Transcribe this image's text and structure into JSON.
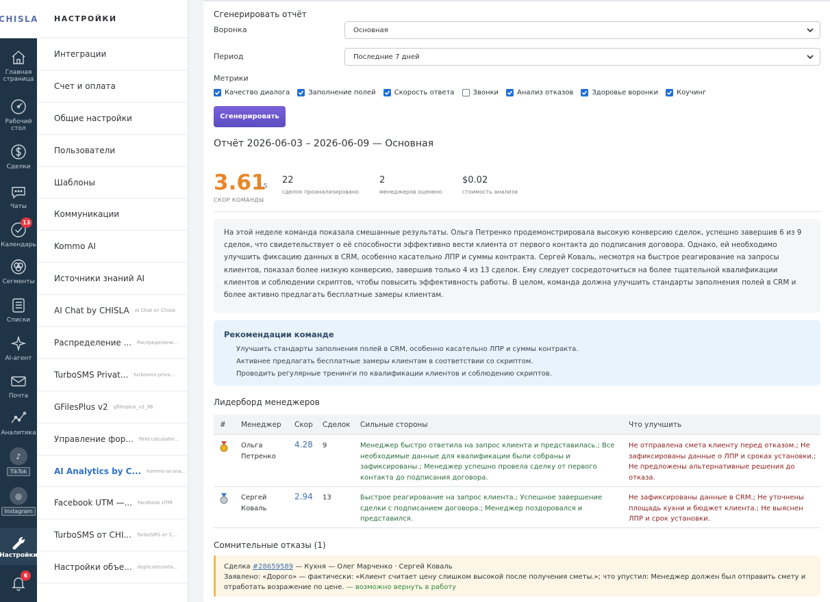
{
  "brand": {
    "logo": "CHISLA"
  },
  "rail": {
    "items": [
      {
        "label": "Главная страница",
        "icon": "home-icon"
      },
      {
        "label": "Рабочий стол",
        "icon": "dashboard-icon"
      },
      {
        "label": "Сделки",
        "icon": "dollar-icon"
      },
      {
        "label": "Чаты",
        "icon": "chat-icon"
      },
      {
        "label": "Календарь",
        "icon": "calendar-check-icon",
        "badge": "13"
      },
      {
        "label": "Сегменты",
        "icon": "segments-icon"
      },
      {
        "label": "Списки",
        "icon": "list-icon"
      },
      {
        "label": "AI-агент",
        "icon": "sparkle-icon"
      },
      {
        "label": "Почта",
        "icon": "mail-icon"
      },
      {
        "label": "Аналитика",
        "icon": "analytics-icon"
      }
    ],
    "tiktok": "TikTok",
    "instagram": "Instagram",
    "settings": "Настройки",
    "notifications_badge": "6"
  },
  "panel": {
    "title": "НАСТРОЙКИ",
    "items": [
      {
        "name": "Интеграции",
        "sub": ""
      },
      {
        "name": "Счет и оплата",
        "sub": ""
      },
      {
        "name": "Общие настройки",
        "sub": ""
      },
      {
        "name": "Пользователи",
        "sub": ""
      },
      {
        "name": "Шаблоны",
        "sub": ""
      },
      {
        "name": "Коммуникации",
        "sub": ""
      },
      {
        "name": "Kommo AI",
        "sub": ""
      },
      {
        "name": "Источники знаний AI",
        "sub": ""
      },
      {
        "name": "AI Chat by CHISLA",
        "sub": "AI Chat от Chisla"
      },
      {
        "name": "Распределение ...",
        "sub": "Распределени..."
      },
      {
        "name": "TurboSMS Privat...",
        "sub": "turbosms-priva..."
      },
      {
        "name": "GFilesPlus v2",
        "sub": "gfilesplus_v2_36"
      },
      {
        "name": "Управление фор...",
        "sub": "field-calculator..."
      },
      {
        "name": "AI Analytics by C...",
        "sub": "kommo-ai-ana..."
      },
      {
        "name": "Facebook UTM —...",
        "sub": "Facebook UTM"
      },
      {
        "name": "TurboSMS от CHI...",
        "sub": "TurboSMS от C..."
      },
      {
        "name": "Настройки объе...",
        "sub": "duplicateconta..."
      }
    ]
  },
  "form": {
    "section_title": "Сгенерировать отчёт",
    "funnel_label": "Воронка",
    "funnel_value": "Основная",
    "period_label": "Период",
    "period_value": "Последние 7 дней",
    "metrics_label": "Метрики",
    "metrics": [
      {
        "label": "Качество диалога",
        "checked": true
      },
      {
        "label": "Заполнение полей",
        "checked": true
      },
      {
        "label": "Скорость ответа",
        "checked": true
      },
      {
        "label": "Звонки",
        "checked": false
      },
      {
        "label": "Анализ отказов",
        "checked": true
      },
      {
        "label": "Здоровье воронки",
        "checked": true
      },
      {
        "label": "Коучинг",
        "checked": true
      }
    ],
    "generate_label": "Сгенерировать"
  },
  "report": {
    "title": "Отчёт 2026-06-03 – 2026-06-09 — Основная",
    "score": "3.61",
    "score_of": "/ 5",
    "score_caption": "СКОР КОМАНДЫ",
    "stats": [
      {
        "value": "22",
        "caption": "сделок проанализировано"
      },
      {
        "value": "2",
        "caption": "менеджеров оценено"
      },
      {
        "value": "$0.02",
        "caption": "стоимость анализа"
      }
    ],
    "summary": "На этой неделе команда показала смешанные результаты. Ольга Петренко продемонстрировала высокую конверсию сделок, успешно завершив 6 из 9 сделок, что свидетельствует о её способности эффективно вести клиента от первого контакта до подписания договора. Однако, ей необходимо улучшить фиксацию данных в CRM, особенно касательно ЛПР и суммы контракта. Сергей Коваль, несмотря на быстрое реагирование на запросы клиентов, показал более низкую конверсию, завершив только 4 из 13 сделок. Ему следует сосредоточиться на более тщательной квалификации клиентов и соблюдении скриптов, чтобы повысить эффективность работы. В целом, команда должна улучшить стандарты заполнения полей в CRM и более активно предлагать бесплатные замеры клиентам.",
    "recs_title": "Рекомендации команде",
    "recs": [
      "Улучшить стандарты заполнения полей в CRM, особенно касательно ЛПР и суммы контракта.",
      "Активнее предлагать бесплатные замеры клиентам в соответствии со скриптом.",
      "Проводить регулярные тренинги по квалификации клиентов и соблюдению скриптов."
    ],
    "leaderboard_title": "Лидерборд менеджеров",
    "columns": [
      "#",
      "Менеджер",
      "Скор",
      "Сделок",
      "Сильные стороны",
      "Что улучшить"
    ],
    "rows": [
      {
        "medal": "gold-medal-icon",
        "manager": "Ольга Петренко",
        "score": "4.28",
        "deals": "9",
        "strengths": "Менеджер быстро ответила на запрос клиента и представилась.; Все необходимые данные для квалификации были собраны и зафиксированы.; Менеджер успешно провела сделку от первого контакта до подписания договора.",
        "improve": "Не отправлена смета клиенту перед отказом.; Не зафиксированы данные о ЛПР и сроках установки.; Не предложены альтернативные решения до отказа."
      },
      {
        "medal": "silver-medal-icon",
        "manager": "Сергей Коваль",
        "score": "2.94",
        "deals": "13",
        "strengths": "Быстрое реагирование на запрос клиента.; Успешное завершение сделки с подписанием договора.; Менеджер поздоровался и представился.",
        "improve": "Не зафиксированы данные в CRM.; Не уточнены площадь кухни и бюджет клиента.; Не выяснен ЛПР и срок установки."
      }
    ],
    "doubt_title": "Сомнительные отказы (1)",
    "doubt": {
      "deal_prefix": "Сделка ",
      "deal_id": "#28659589",
      "deal_rest": " — Кухня — Олег Марченко · Сергей Коваль",
      "claim": "Заявлено: «Дорого» — фактически: «Клиент считает цену слишком высокой после получения сметы.»; что упустил: Менеджер должен был отправить смету и отработать возражение по цене. ",
      "verdict": "— возможно вернуть в работу"
    }
  }
}
